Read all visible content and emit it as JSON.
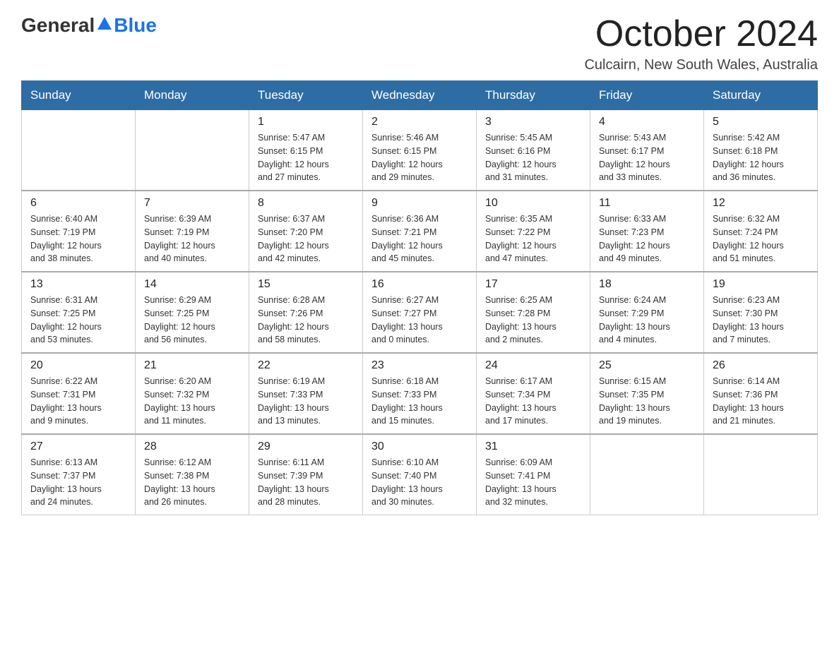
{
  "header": {
    "logo_general": "General",
    "logo_blue": "Blue",
    "month_title": "October 2024",
    "location": "Culcairn, New South Wales, Australia"
  },
  "days_of_week": [
    "Sunday",
    "Monday",
    "Tuesday",
    "Wednesday",
    "Thursday",
    "Friday",
    "Saturday"
  ],
  "weeks": [
    [
      {
        "day": "",
        "details": ""
      },
      {
        "day": "",
        "details": ""
      },
      {
        "day": "1",
        "details": "Sunrise: 5:47 AM\nSunset: 6:15 PM\nDaylight: 12 hours\nand 27 minutes."
      },
      {
        "day": "2",
        "details": "Sunrise: 5:46 AM\nSunset: 6:15 PM\nDaylight: 12 hours\nand 29 minutes."
      },
      {
        "day": "3",
        "details": "Sunrise: 5:45 AM\nSunset: 6:16 PM\nDaylight: 12 hours\nand 31 minutes."
      },
      {
        "day": "4",
        "details": "Sunrise: 5:43 AM\nSunset: 6:17 PM\nDaylight: 12 hours\nand 33 minutes."
      },
      {
        "day": "5",
        "details": "Sunrise: 5:42 AM\nSunset: 6:18 PM\nDaylight: 12 hours\nand 36 minutes."
      }
    ],
    [
      {
        "day": "6",
        "details": "Sunrise: 6:40 AM\nSunset: 7:19 PM\nDaylight: 12 hours\nand 38 minutes."
      },
      {
        "day": "7",
        "details": "Sunrise: 6:39 AM\nSunset: 7:19 PM\nDaylight: 12 hours\nand 40 minutes."
      },
      {
        "day": "8",
        "details": "Sunrise: 6:37 AM\nSunset: 7:20 PM\nDaylight: 12 hours\nand 42 minutes."
      },
      {
        "day": "9",
        "details": "Sunrise: 6:36 AM\nSunset: 7:21 PM\nDaylight: 12 hours\nand 45 minutes."
      },
      {
        "day": "10",
        "details": "Sunrise: 6:35 AM\nSunset: 7:22 PM\nDaylight: 12 hours\nand 47 minutes."
      },
      {
        "day": "11",
        "details": "Sunrise: 6:33 AM\nSunset: 7:23 PM\nDaylight: 12 hours\nand 49 minutes."
      },
      {
        "day": "12",
        "details": "Sunrise: 6:32 AM\nSunset: 7:24 PM\nDaylight: 12 hours\nand 51 minutes."
      }
    ],
    [
      {
        "day": "13",
        "details": "Sunrise: 6:31 AM\nSunset: 7:25 PM\nDaylight: 12 hours\nand 53 minutes."
      },
      {
        "day": "14",
        "details": "Sunrise: 6:29 AM\nSunset: 7:25 PM\nDaylight: 12 hours\nand 56 minutes."
      },
      {
        "day": "15",
        "details": "Sunrise: 6:28 AM\nSunset: 7:26 PM\nDaylight: 12 hours\nand 58 minutes."
      },
      {
        "day": "16",
        "details": "Sunrise: 6:27 AM\nSunset: 7:27 PM\nDaylight: 13 hours\nand 0 minutes."
      },
      {
        "day": "17",
        "details": "Sunrise: 6:25 AM\nSunset: 7:28 PM\nDaylight: 13 hours\nand 2 minutes."
      },
      {
        "day": "18",
        "details": "Sunrise: 6:24 AM\nSunset: 7:29 PM\nDaylight: 13 hours\nand 4 minutes."
      },
      {
        "day": "19",
        "details": "Sunrise: 6:23 AM\nSunset: 7:30 PM\nDaylight: 13 hours\nand 7 minutes."
      }
    ],
    [
      {
        "day": "20",
        "details": "Sunrise: 6:22 AM\nSunset: 7:31 PM\nDaylight: 13 hours\nand 9 minutes."
      },
      {
        "day": "21",
        "details": "Sunrise: 6:20 AM\nSunset: 7:32 PM\nDaylight: 13 hours\nand 11 minutes."
      },
      {
        "day": "22",
        "details": "Sunrise: 6:19 AM\nSunset: 7:33 PM\nDaylight: 13 hours\nand 13 minutes."
      },
      {
        "day": "23",
        "details": "Sunrise: 6:18 AM\nSunset: 7:33 PM\nDaylight: 13 hours\nand 15 minutes."
      },
      {
        "day": "24",
        "details": "Sunrise: 6:17 AM\nSunset: 7:34 PM\nDaylight: 13 hours\nand 17 minutes."
      },
      {
        "day": "25",
        "details": "Sunrise: 6:15 AM\nSunset: 7:35 PM\nDaylight: 13 hours\nand 19 minutes."
      },
      {
        "day": "26",
        "details": "Sunrise: 6:14 AM\nSunset: 7:36 PM\nDaylight: 13 hours\nand 21 minutes."
      }
    ],
    [
      {
        "day": "27",
        "details": "Sunrise: 6:13 AM\nSunset: 7:37 PM\nDaylight: 13 hours\nand 24 minutes."
      },
      {
        "day": "28",
        "details": "Sunrise: 6:12 AM\nSunset: 7:38 PM\nDaylight: 13 hours\nand 26 minutes."
      },
      {
        "day": "29",
        "details": "Sunrise: 6:11 AM\nSunset: 7:39 PM\nDaylight: 13 hours\nand 28 minutes."
      },
      {
        "day": "30",
        "details": "Sunrise: 6:10 AM\nSunset: 7:40 PM\nDaylight: 13 hours\nand 30 minutes."
      },
      {
        "day": "31",
        "details": "Sunrise: 6:09 AM\nSunset: 7:41 PM\nDaylight: 13 hours\nand 32 minutes."
      },
      {
        "day": "",
        "details": ""
      },
      {
        "day": "",
        "details": ""
      }
    ]
  ]
}
